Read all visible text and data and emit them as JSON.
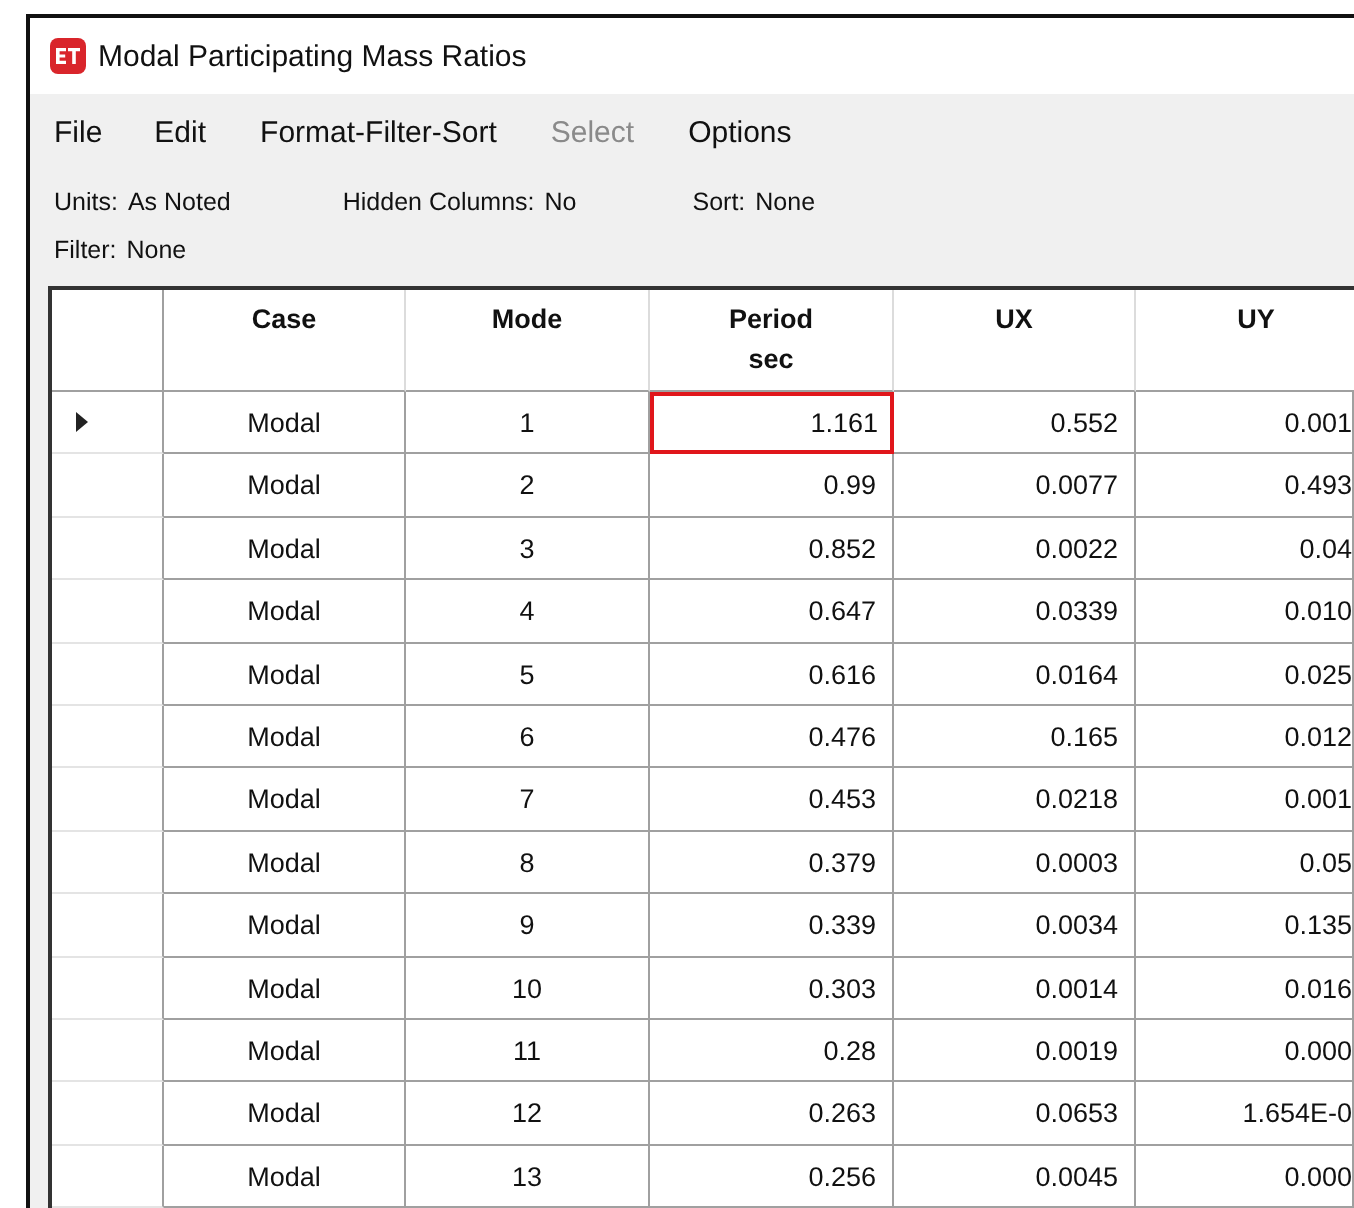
{
  "window": {
    "title": "Modal Participating Mass Ratios"
  },
  "menu": [
    {
      "label": "File",
      "disabled": false
    },
    {
      "label": "Edit",
      "disabled": false
    },
    {
      "label": "Format-Filter-Sort",
      "disabled": false
    },
    {
      "label": "Select",
      "disabled": true
    },
    {
      "label": "Options",
      "disabled": false
    }
  ],
  "info": [
    {
      "label": "Units:",
      "value": "As Noted"
    },
    {
      "label": "Hidden Columns:",
      "value": "No"
    },
    {
      "label": "Sort:",
      "value": "None"
    },
    {
      "label": "Filter:",
      "value": "None"
    }
  ],
  "table": {
    "columns": [
      {
        "title": "Case"
      },
      {
        "title": "Mode"
      },
      {
        "title": "Period",
        "unit": "sec"
      },
      {
        "title": "UX"
      },
      {
        "title": "UY"
      }
    ],
    "rows": [
      {
        "selected": true,
        "period_focused": true,
        "cells": [
          "Modal",
          "1",
          "1.161",
          "0.552",
          "0.001"
        ]
      },
      {
        "selected": false,
        "period_focused": false,
        "cells": [
          "Modal",
          "2",
          "0.99",
          "0.0077",
          "0.493"
        ]
      },
      {
        "selected": false,
        "period_focused": false,
        "cells": [
          "Modal",
          "3",
          "0.852",
          "0.0022",
          "0.04"
        ]
      },
      {
        "selected": false,
        "period_focused": false,
        "cells": [
          "Modal",
          "4",
          "0.647",
          "0.0339",
          "0.010"
        ]
      },
      {
        "selected": false,
        "period_focused": false,
        "cells": [
          "Modal",
          "5",
          "0.616",
          "0.0164",
          "0.025"
        ]
      },
      {
        "selected": false,
        "period_focused": false,
        "cells": [
          "Modal",
          "6",
          "0.476",
          "0.165",
          "0.012"
        ]
      },
      {
        "selected": false,
        "period_focused": false,
        "cells": [
          "Modal",
          "7",
          "0.453",
          "0.0218",
          "0.001"
        ]
      },
      {
        "selected": false,
        "period_focused": false,
        "cells": [
          "Modal",
          "8",
          "0.379",
          "0.0003",
          "0.05"
        ]
      },
      {
        "selected": false,
        "period_focused": false,
        "cells": [
          "Modal",
          "9",
          "0.339",
          "0.0034",
          "0.135"
        ]
      },
      {
        "selected": false,
        "period_focused": false,
        "cells": [
          "Modal",
          "10",
          "0.303",
          "0.0014",
          "0.016"
        ]
      },
      {
        "selected": false,
        "period_focused": false,
        "cells": [
          "Modal",
          "11",
          "0.28",
          "0.0019",
          "0.000"
        ]
      },
      {
        "selected": false,
        "period_focused": false,
        "cells": [
          "Modal",
          "12",
          "0.263",
          "0.0653",
          "1.654E-0"
        ]
      },
      {
        "selected": false,
        "period_focused": false,
        "cells": [
          "Modal",
          "13",
          "0.256",
          "0.0045",
          "0.000"
        ]
      }
    ]
  }
}
